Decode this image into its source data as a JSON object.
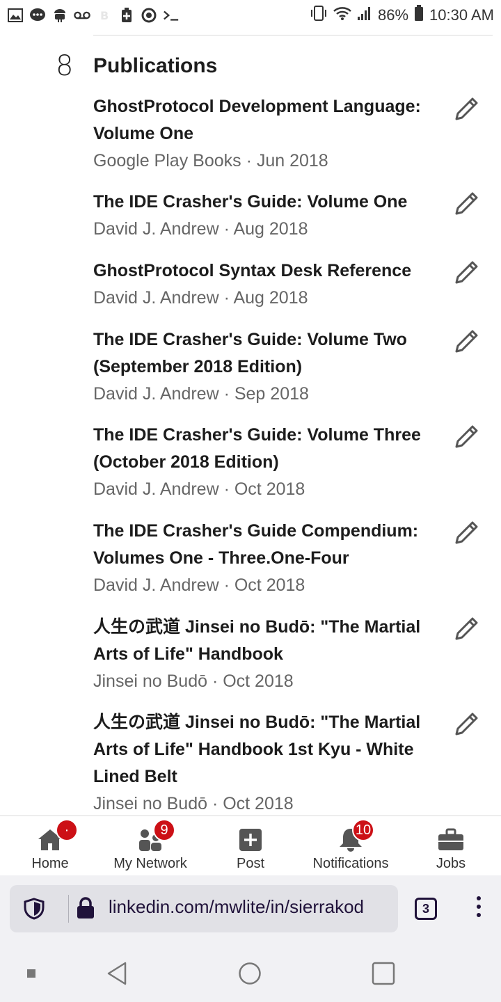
{
  "status": {
    "battery": "86%",
    "time": "10:30 AM"
  },
  "section": {
    "count": "8",
    "title": "Publications"
  },
  "publications": [
    {
      "title": "GhostProtocol Development Language: Volume One",
      "subtitle": "Google Play Books · Jun 2018"
    },
    {
      "title": "The IDE Crasher's Guide: Volume One",
      "subtitle": "David J. Andrew · Aug 2018"
    },
    {
      "title": "GhostProtocol Syntax Desk Reference",
      "subtitle": "David J. Andrew · Aug 2018"
    },
    {
      "title": "The IDE Crasher's Guide: Volume Two (September 2018 Edition)",
      "subtitle": "David J. Andrew · Sep 2018"
    },
    {
      "title": "The IDE Crasher's Guide: Volume Three (October 2018 Edition)",
      "subtitle": "David J. Andrew · Oct 2018"
    },
    {
      "title": "The IDE Crasher's Guide Compendium: Volumes One - Three.One-Four",
      "subtitle": "David J. Andrew · Oct 2018"
    },
    {
      "title": "人生の武道 Jinsei no Budō: \"The Martial Arts of Life\" Handbook",
      "subtitle": "Jinsei no Budō · Oct 2018"
    },
    {
      "title": "人生の武道 Jinsei no Budō: \"The Martial Arts of Life\" Handbook 1st Kyu - White Lined Belt",
      "subtitle": "Jinsei no Budō · Oct 2018"
    }
  ],
  "nav": {
    "home": {
      "label": "Home",
      "badge": "·"
    },
    "network": {
      "label": "My Network",
      "badge": "9"
    },
    "post": {
      "label": "Post"
    },
    "notifications": {
      "label": "Notifications",
      "badge": "10"
    },
    "jobs": {
      "label": "Jobs"
    }
  },
  "browser": {
    "url": "linkedin.com/mwlite/in/sierrakod",
    "tab_count": "3"
  },
  "colors": {
    "badge": "#cc1016",
    "browser_accent": "#20123a"
  }
}
